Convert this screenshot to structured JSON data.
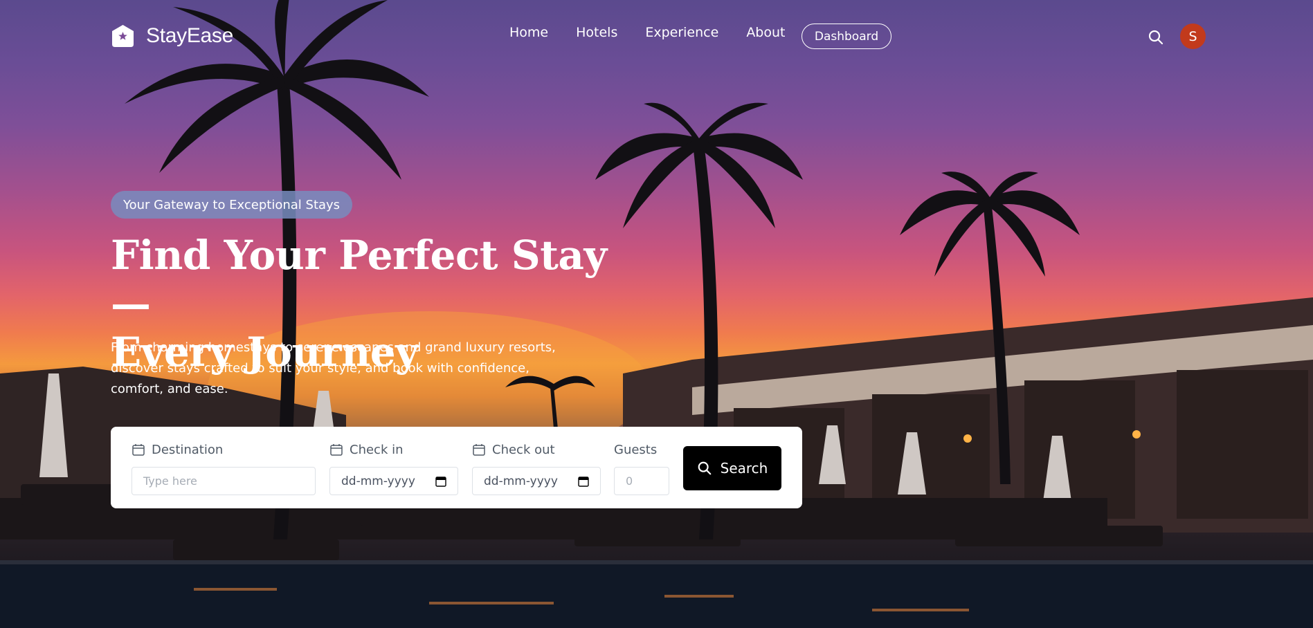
{
  "brand": {
    "name": "StayEase"
  },
  "nav": {
    "links": [
      "Home",
      "Hotels",
      "Experience",
      "About"
    ],
    "dashboard_label": "Dashboard",
    "avatar_initial": "S"
  },
  "hero": {
    "badge": "Your Gateway to Exceptional Stays",
    "headline_line1": "Find Your Perfect Stay —",
    "headline_line2": "Every Journey",
    "subtext": "From charming homestays to serene escapes and grand luxury resorts, discover stays crafted to suit your style, and book with confidence, comfort, and ease."
  },
  "search": {
    "destination": {
      "label": "Destination",
      "placeholder": "Type here"
    },
    "checkin": {
      "label": "Check in",
      "value": "dd-mm-yyyy"
    },
    "checkout": {
      "label": "Check out",
      "value": "dd-mm-yyyy"
    },
    "guests": {
      "label": "Guests",
      "placeholder": "0"
    },
    "button_label": "Search"
  },
  "colors": {
    "avatar": "#c23a1c",
    "search_button": "#000000",
    "badge": "#788cbe"
  },
  "icons": [
    "logo-house-icon",
    "search-icon",
    "calendar-icon"
  ]
}
